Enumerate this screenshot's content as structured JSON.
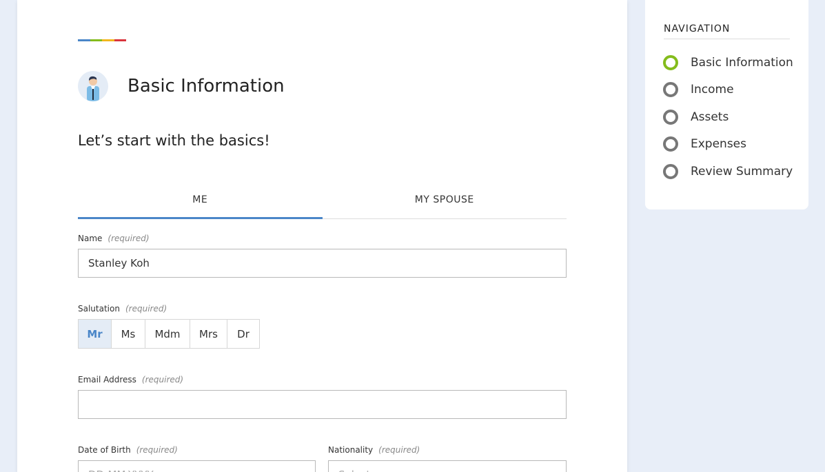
{
  "colors": {
    "accent_blue": "#4a86c8",
    "accent_green": "#84bc1c",
    "accent_yellow": "#f2b61e",
    "accent_red": "#d9343c",
    "background": "#e8eef8"
  },
  "header": {
    "title": "Basic Information",
    "subtitle": "Let’s start with the basics!",
    "avatar_icon": "person-avatar-icon"
  },
  "tabs": [
    {
      "label": "ME",
      "active": true
    },
    {
      "label": "MY SPOUSE",
      "active": false
    }
  ],
  "form": {
    "required_text": "(required)",
    "name": {
      "label": "Name",
      "value": "Stanley Koh"
    },
    "salutation": {
      "label": "Salutation",
      "options": [
        "Mr",
        "Ms",
        "Mdm",
        "Mrs",
        "Dr"
      ],
      "selected": "Mr"
    },
    "email": {
      "label": "Email Address",
      "value": ""
    },
    "dob": {
      "label": "Date of Birth",
      "placeholder": "DD-MM-YYYY"
    },
    "nationality": {
      "label": "Nationality",
      "placeholder": "Select"
    }
  },
  "navigation": {
    "heading": "NAVIGATION",
    "items": [
      {
        "label": "Basic Information",
        "active": true
      },
      {
        "label": "Income",
        "active": false
      },
      {
        "label": "Assets",
        "active": false
      },
      {
        "label": "Expenses",
        "active": false
      },
      {
        "label": "Review Summary",
        "active": false
      }
    ]
  }
}
